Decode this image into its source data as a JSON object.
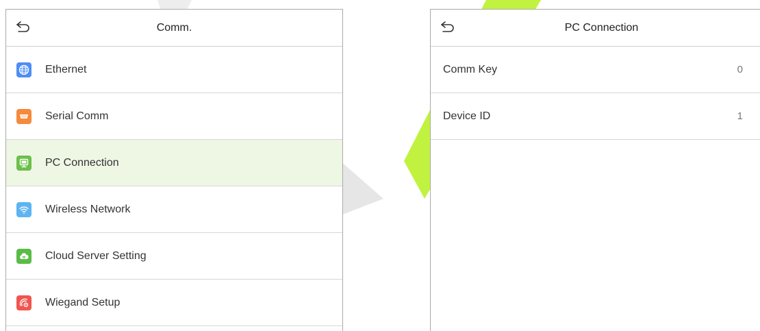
{
  "left_panel": {
    "title": "Comm.",
    "items": [
      {
        "label": "Ethernet",
        "icon": "globe-icon",
        "color": "#4f8df5"
      },
      {
        "label": "Serial Comm",
        "icon": "serial-port-icon",
        "color": "#f58a3c"
      },
      {
        "label": "PC Connection",
        "icon": "monitor-icon",
        "color": "#6cbf4b",
        "selected": true
      },
      {
        "label": "Wireless Network",
        "icon": "wifi-icon",
        "color": "#5db4f2"
      },
      {
        "label": "Cloud Server Setting",
        "icon": "cloud-icon",
        "color": "#5bbb48"
      },
      {
        "label": "Wiegand Setup",
        "icon": "wiegand-icon",
        "color": "#f0564f"
      }
    ]
  },
  "right_panel": {
    "title": "PC Connection",
    "settings": [
      {
        "label": "Comm Key",
        "value": "0"
      },
      {
        "label": "Device ID",
        "value": "1"
      }
    ]
  },
  "colors": {
    "selected_row_bg": "#eef6e4",
    "watermark_green": "#b6f01e",
    "watermark_gray": "#d9d9d9"
  }
}
